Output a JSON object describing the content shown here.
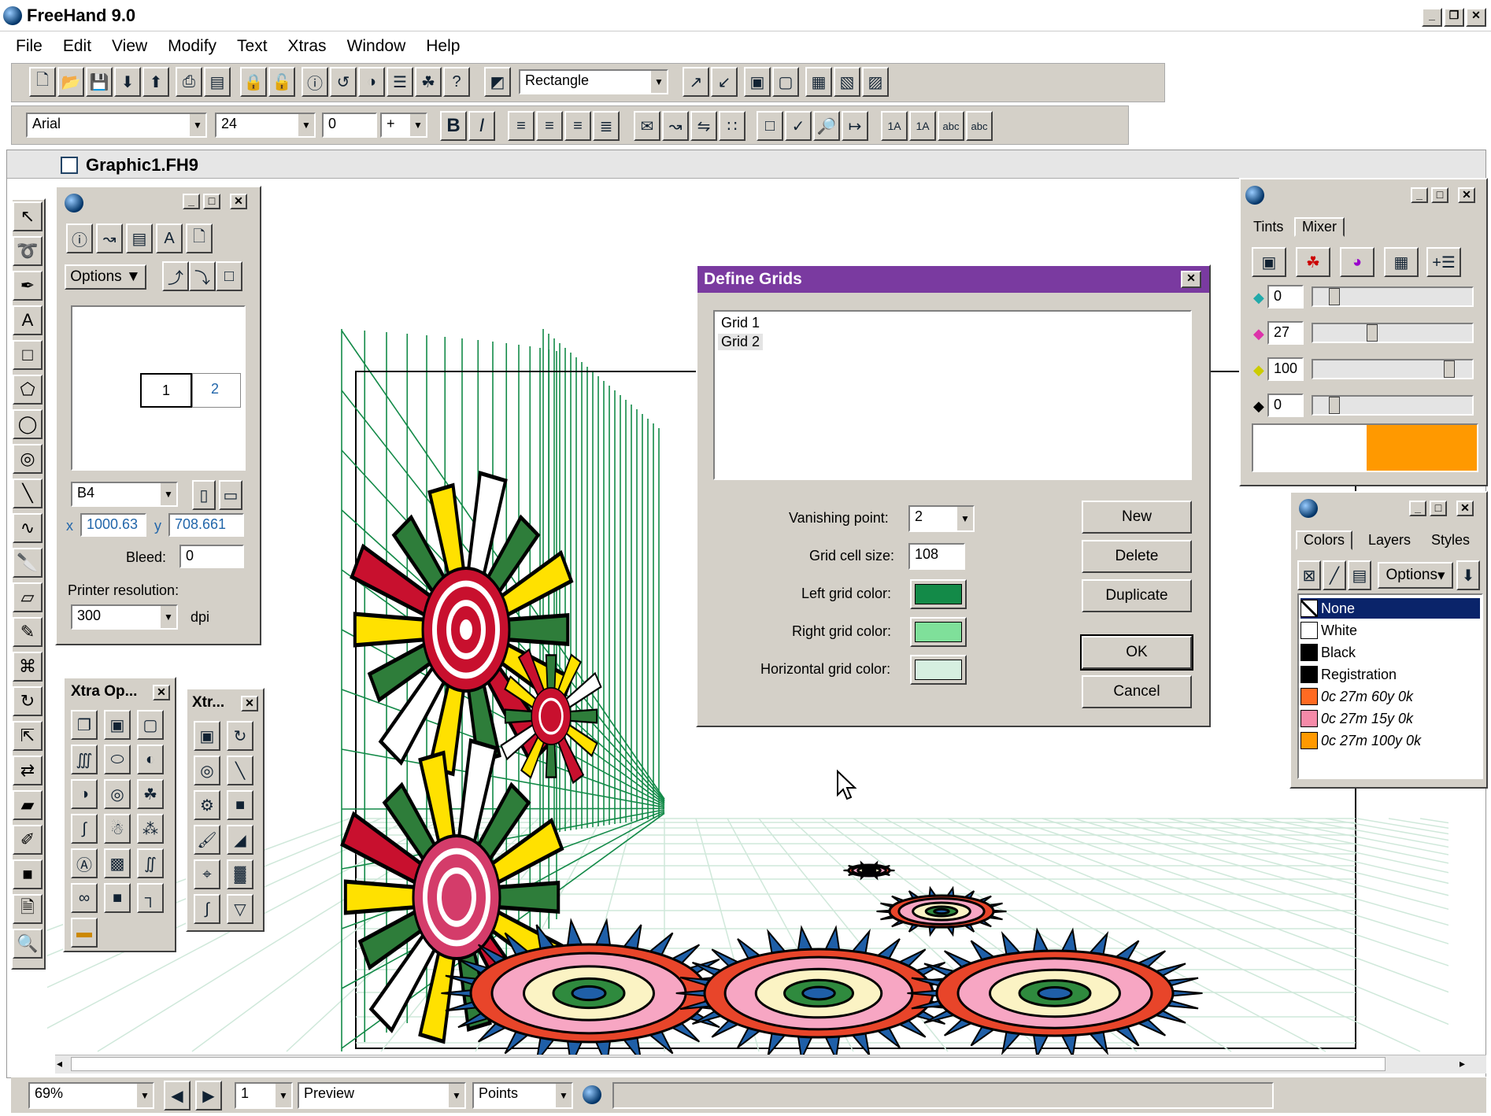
{
  "app": {
    "title": "FreeHand 9.0"
  },
  "menu": [
    "File",
    "Edit",
    "View",
    "Modify",
    "Text",
    "Xtras",
    "Window",
    "Help"
  ],
  "toolbar": {
    "shape_select": "Rectangle"
  },
  "textbar": {
    "font": "Arial",
    "size": "24",
    "leading": "0",
    "leading_mode": "+"
  },
  "document": {
    "title": "Graphic1.FH9"
  },
  "inspector": {
    "options_label": "Options",
    "pages": [
      "1",
      "2"
    ],
    "page_size": "B4",
    "x_label": "x",
    "x_value": "1000.63",
    "y_label": "y",
    "y_value": "708.661",
    "bleed_label": "Bleed:",
    "bleed_value": "0",
    "res_label": "Printer resolution:",
    "res_value": "300",
    "res_unit": "dpi"
  },
  "xtra_ops": {
    "title": "Xtra Op..."
  },
  "xtra_tools": {
    "title": "Xtr..."
  },
  "dialog": {
    "title": "Define Grids",
    "grids": [
      "Grid 1",
      "Grid 2"
    ],
    "vanishing_label": "Vanishing point:",
    "vanishing_value": "2",
    "cell_label": "Grid cell size:",
    "cell_value": "108",
    "left_label": "Left grid color:",
    "right_label": "Right grid color:",
    "horiz_label": "Horizontal grid color:",
    "left_color": "#138a48",
    "right_color": "#7fe09a",
    "horiz_color": "#d6efe0",
    "new": "New",
    "delete": "Delete",
    "duplicate": "Duplicate",
    "ok": "OK",
    "cancel": "Cancel"
  },
  "mixer": {
    "tabs": [
      "Tints",
      "Mixer"
    ],
    "c": "0",
    "m": "27",
    "y": "100",
    "k": "0",
    "preview_color": "#ff9900"
  },
  "colors_panel": {
    "tabs": [
      "Colors",
      "Layers",
      "Styles"
    ],
    "options_label": "Options",
    "items": [
      {
        "name": "None",
        "color": "#ffffff"
      },
      {
        "name": "White",
        "color": "#ffffff"
      },
      {
        "name": "Black",
        "color": "#000000"
      },
      {
        "name": "Registration",
        "color": "#000000"
      },
      {
        "name": "0c 27m 60y 0k",
        "color": "#ff6a22"
      },
      {
        "name": "0c 27m 15y 0k",
        "color": "#f58aa8"
      },
      {
        "name": "0c 27m 100y 0k",
        "color": "#ff9900"
      }
    ]
  },
  "status": {
    "zoom": "69%",
    "page": "1",
    "view_mode": "Preview",
    "units": "Points"
  }
}
